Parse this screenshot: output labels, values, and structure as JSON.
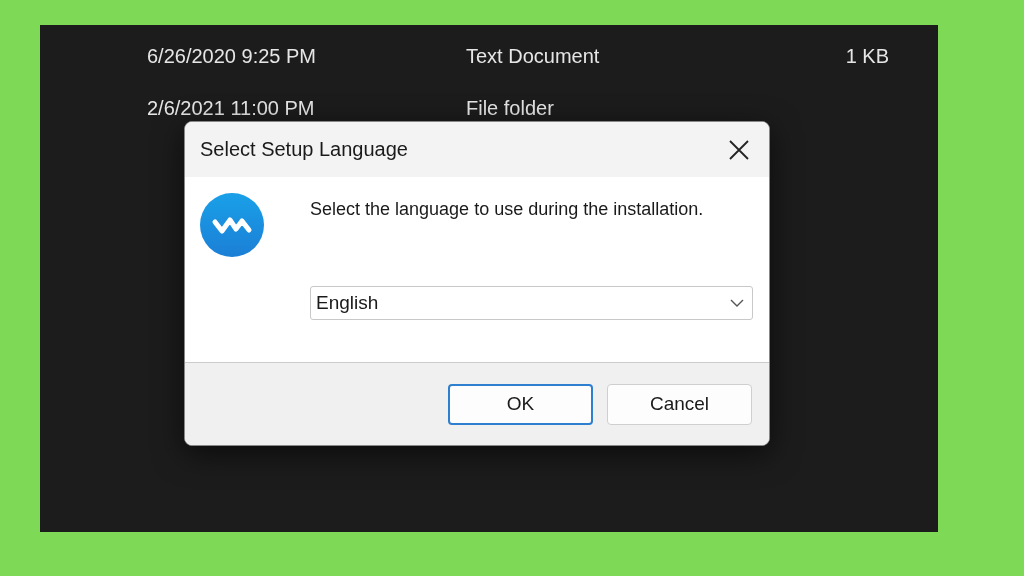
{
  "background_files": [
    {
      "date_modified": "6/26/2020 9:25 PM",
      "type": "Text Document",
      "size": "1 KB"
    },
    {
      "date_modified": "2/6/2021 11:00 PM",
      "type": "File folder"
    }
  ],
  "dialog": {
    "title": "Select Setup Language",
    "message": "Select the language to use during the installation.",
    "language_select": {
      "value": "English"
    },
    "buttons": [
      {
        "label": "OK",
        "selected": true
      },
      {
        "label": "Cancel",
        "selected": false
      }
    ]
  }
}
